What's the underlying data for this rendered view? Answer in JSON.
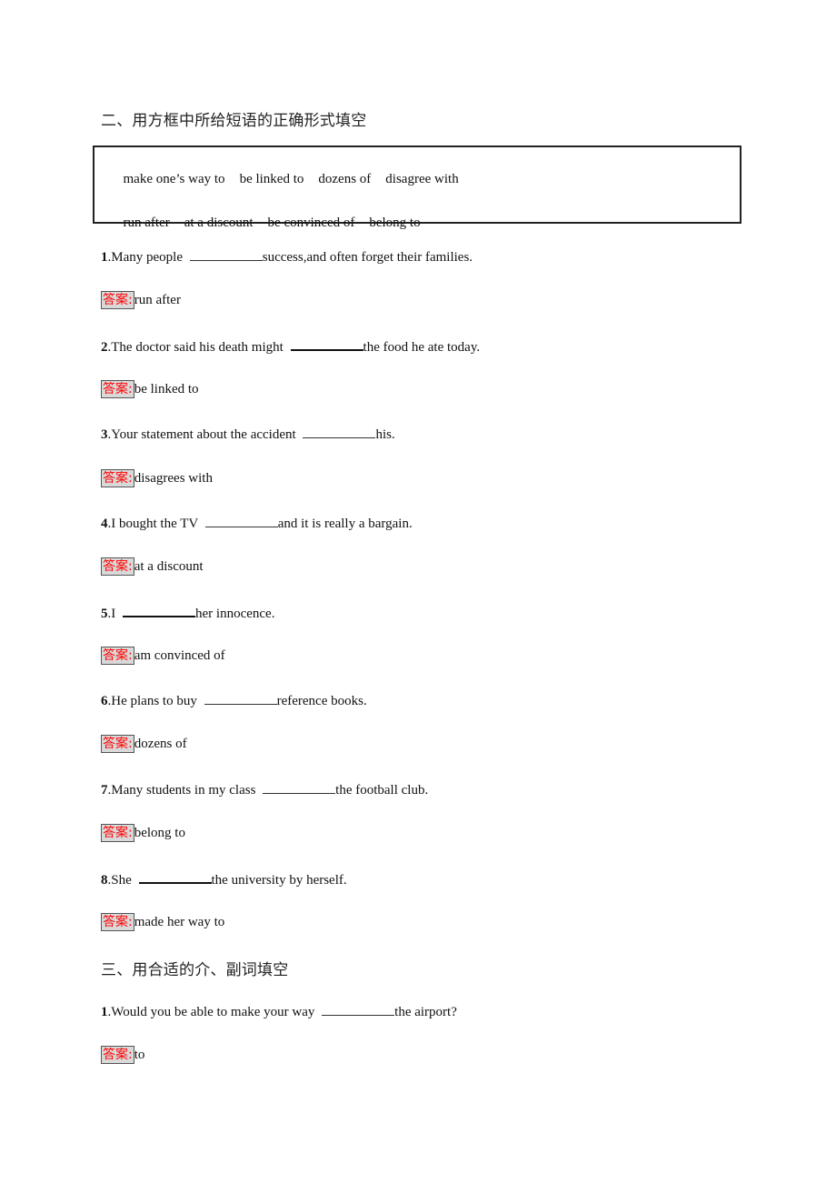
{
  "section2": {
    "heading": "二、用方框中所给短语的正确形式填空",
    "phrase_rows": [
      [
        "make one’s way to",
        "be linked to",
        "dozens of",
        "disagree with"
      ],
      [
        "run after",
        "at a discount",
        "be convinced of",
        "belong to"
      ]
    ],
    "answer_label": "答案:",
    "questions": [
      {
        "num": "1",
        "before": ".Many people ",
        "after": "success,and often forget their families.",
        "answer": "run after"
      },
      {
        "num": "2",
        "before": ".The doctor said his death might ",
        "after": "the food he ate today.",
        "answer": "be linked to"
      },
      {
        "num": "3",
        "before": ".Your statement about the accident ",
        "after": "his.",
        "answer": "disagrees with"
      },
      {
        "num": "4",
        "before": ".I bought the TV ",
        "after": "and it is really a bargain.",
        "answer": "at a discount"
      },
      {
        "num": "5",
        "before": ".I ",
        "after": "her innocence.",
        "answer": "am convinced of"
      },
      {
        "num": "6",
        "before": ".He plans to buy ",
        "after": "reference books.",
        "answer": "dozens of"
      },
      {
        "num": "7",
        "before": ".Many students in my class ",
        "after": "the football club.",
        "answer": "belong to"
      },
      {
        "num": "8",
        "before": ".She ",
        "after": "the university by herself.",
        "answer": "made her way to"
      }
    ]
  },
  "section3": {
    "heading": "三、用合适的介、副词填空",
    "answer_label": "答案:",
    "questions": [
      {
        "num": "1",
        "before": ".Would you be able to make your way ",
        "after": "the airport?",
        "answer": "to"
      }
    ]
  }
}
